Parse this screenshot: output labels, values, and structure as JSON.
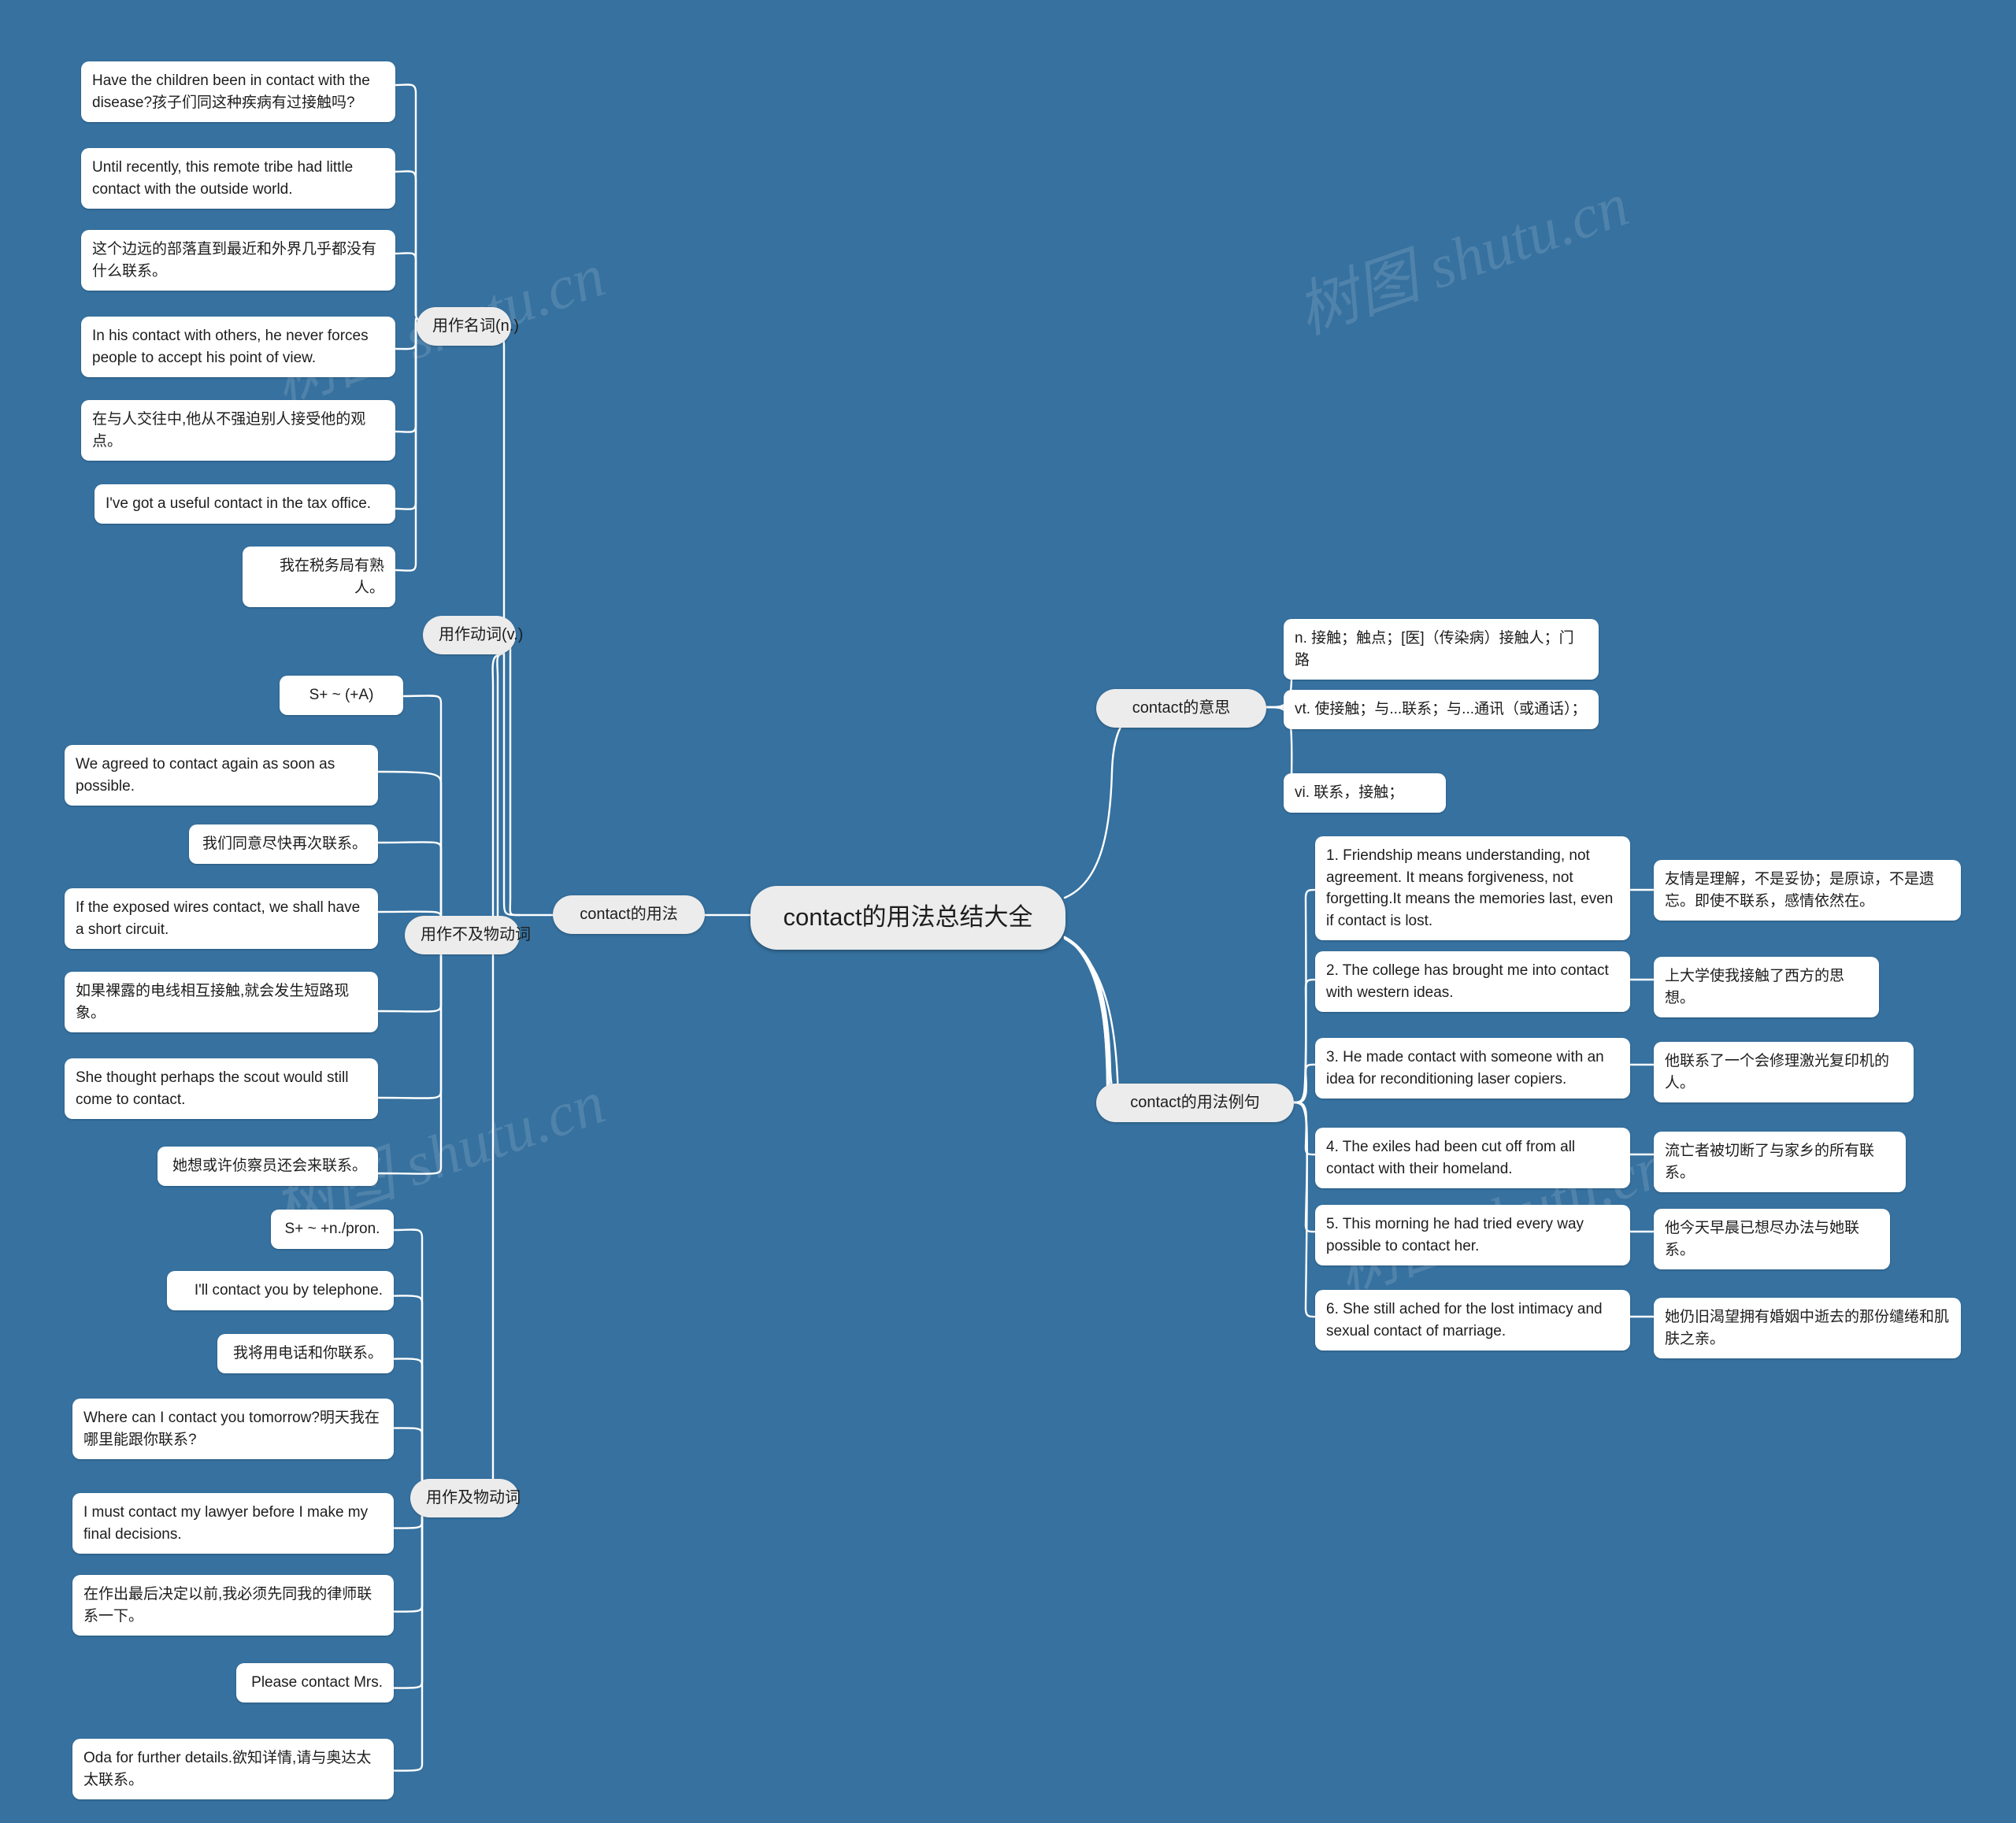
{
  "theme": {
    "background": "#36719f",
    "node_fill": "#ffffff",
    "branch_fill": "#ececec",
    "text_color": "#1d1d1d",
    "link_color": "#ffffff"
  },
  "watermarks": [
    "树图 shutu.cn",
    "树图 shutu.cn",
    "树图 shutu.cn",
    "树图 shutu.cn"
  ],
  "root": {
    "label": "contact的用法总结大全"
  },
  "branches": {
    "usage": {
      "label": "contact的用法"
    },
    "meaning": {
      "label": "contact的意思"
    },
    "examples": {
      "label": "contact的用法例句"
    }
  },
  "usage": {
    "noun": {
      "label": "用作名词(n.)"
    },
    "verb": {
      "label": "用作动词(v.)"
    },
    "intransitive": {
      "label": "用作不及物动词"
    },
    "transitive": {
      "label": "用作及物动词"
    },
    "pattern_intransitive": {
      "label": "S+ ~ (+A)"
    },
    "pattern_transitive": {
      "label": "S+ ~ +n./pron."
    }
  },
  "noun_examples": [
    {
      "text": "Have the children been in contact with the disease?孩子们同这种疾病有过接触吗?"
    },
    {
      "text": "Until recently, this remote tribe had little contact with the outside world."
    },
    {
      "text": "这个边远的部落直到最近和外界几乎都没有什么联系。"
    },
    {
      "text": "In his contact with others, he never forces people to accept his point of view."
    },
    {
      "text": "在与人交往中,他从不强迫别人接受他的观点。"
    },
    {
      "text": "I've got a useful contact in the tax office."
    },
    {
      "text": "我在税务局有熟人。"
    }
  ],
  "intransitive_examples": [
    {
      "text": "We agreed to contact again as soon as possible."
    },
    {
      "text": "我们同意尽快再次联系。"
    },
    {
      "text": "If the exposed wires contact, we shall have a short circuit."
    },
    {
      "text": "如果裸露的电线相互接触,就会发生短路现象。"
    },
    {
      "text": "She thought perhaps the scout would still come to contact."
    },
    {
      "text": "她想或许侦察员还会来联系。"
    }
  ],
  "transitive_examples": [
    {
      "text": "I'll contact you by telephone."
    },
    {
      "text": "我将用电话和你联系。"
    },
    {
      "text": "Where can I contact you tomorrow?明天我在哪里能跟你联系?"
    },
    {
      "text": "I must contact my lawyer before I make my final decisions."
    },
    {
      "text": "在作出最后决定以前,我必须先同我的律师联系一下。"
    },
    {
      "text": "Please contact Mrs."
    },
    {
      "text": "Oda for further details.欲知详情,请与奥达太太联系。"
    }
  ],
  "meanings": [
    {
      "text": "n. 接触；触点；[医]（传染病）接触人；门路"
    },
    {
      "text": "vt. 使接触；与...联系；与...通讯（或通话）；"
    },
    {
      "text": "vi. 联系，接触；"
    }
  ],
  "example_sentences": [
    {
      "en": "1. Friendship means understanding, not agreement. It means forgiveness, not forgetting.It means the memories last, even if contact is lost.",
      "zh": "友情是理解，不是妥协；是原谅，不是遗忘。即使不联系，感情依然在。"
    },
    {
      "en": "2. The college has brought me into contact with western ideas.",
      "zh": "上大学使我接触了西方的思想。"
    },
    {
      "en": "3. He made contact with someone with an idea for reconditioning laser copiers.",
      "zh": "他联系了一个会修理激光复印机的人。"
    },
    {
      "en": "4. The exiles had been cut off from all contact with their homeland.",
      "zh": "流亡者被切断了与家乡的所有联系。"
    },
    {
      "en": "5. This morning he had tried every way possible to contact her.",
      "zh": "他今天早晨已想尽办法与她联系。"
    },
    {
      "en": "6. She still ached for the lost intimacy and sexual contact of marriage.",
      "zh": "她仍旧渴望拥有婚姻中逝去的那份缱绻和肌肤之亲。"
    }
  ]
}
